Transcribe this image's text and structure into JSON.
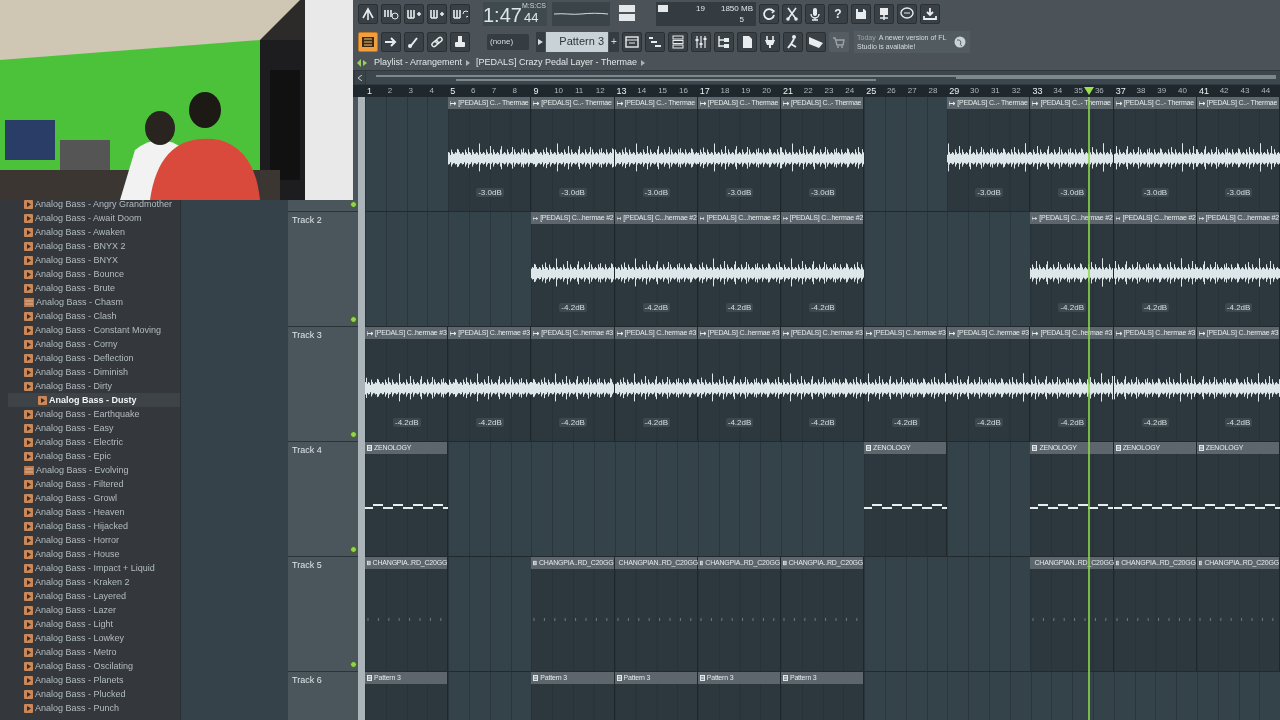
{
  "toolbar": {
    "time": "1:47",
    "time_cs": "44",
    "time_label": "M:S:CS",
    "cpu": "19",
    "memory": "1850 MB",
    "polyphony": "5",
    "help_button": "?",
    "pattern_mode": "(none)",
    "pattern": "Pattern 3",
    "add_pattern": "+",
    "news_date": "Today",
    "news_message": "A newer version of FL Studio is available!"
  },
  "breadcrumb": {
    "title": "Playlist - Arrangement",
    "item": "[PEDALS] Crazy Pedal Layer - Thermae"
  },
  "browser": {
    "items": [
      {
        "label": "Analog Bass - Angry Grandmother",
        "kind": "preset",
        "selected": false
      },
      {
        "label": "Analog Bass - Await Doom",
        "kind": "preset",
        "selected": false
      },
      {
        "label": "Analog Bass - Awaken",
        "kind": "preset",
        "selected": false
      },
      {
        "label": "Analog Bass - BNYX 2",
        "kind": "preset",
        "selected": false
      },
      {
        "label": "Analog Bass - BNYX",
        "kind": "preset",
        "selected": false
      },
      {
        "label": "Analog Bass - Bounce",
        "kind": "preset",
        "selected": false
      },
      {
        "label": "Analog Bass - Brute",
        "kind": "preset",
        "selected": false
      },
      {
        "label": "Analog Bass - Chasm",
        "kind": "audio",
        "selected": false
      },
      {
        "label": "Analog Bass - Clash",
        "kind": "preset",
        "selected": false
      },
      {
        "label": "Analog Bass - Constant Moving",
        "kind": "preset",
        "selected": false
      },
      {
        "label": "Analog Bass - Corny",
        "kind": "preset",
        "selected": false
      },
      {
        "label": "Analog Bass - Deflection",
        "kind": "preset",
        "selected": false
      },
      {
        "label": "Analog Bass - Diminish",
        "kind": "preset",
        "selected": false
      },
      {
        "label": "Analog Bass - Dirty",
        "kind": "preset",
        "selected": false
      },
      {
        "label": "Analog Bass - Dusty",
        "kind": "preset",
        "selected": true
      },
      {
        "label": "Analog Bass - Earthquake",
        "kind": "preset",
        "selected": false
      },
      {
        "label": "Analog Bass - Easy",
        "kind": "preset",
        "selected": false
      },
      {
        "label": "Analog Bass - Electric",
        "kind": "preset",
        "selected": false
      },
      {
        "label": "Analog Bass - Epic",
        "kind": "preset",
        "selected": false
      },
      {
        "label": "Analog Bass - Evolving",
        "kind": "audio",
        "selected": false
      },
      {
        "label": "Analog Bass - Filtered",
        "kind": "preset",
        "selected": false
      },
      {
        "label": "Analog Bass - Growl",
        "kind": "preset",
        "selected": false
      },
      {
        "label": "Analog Bass - Heaven",
        "kind": "preset",
        "selected": false
      },
      {
        "label": "Analog Bass - Hijacked",
        "kind": "preset",
        "selected": false
      },
      {
        "label": "Analog Bass - Horror",
        "kind": "preset",
        "selected": false
      },
      {
        "label": "Analog Bass - House",
        "kind": "preset",
        "selected": false
      },
      {
        "label": "Analog Bass - Impact + Liquid",
        "kind": "preset",
        "selected": false
      },
      {
        "label": "Analog Bass - Kraken 2",
        "kind": "preset",
        "selected": false
      },
      {
        "label": "Analog Bass - Layered",
        "kind": "preset",
        "selected": false
      },
      {
        "label": "Analog Bass - Lazer",
        "kind": "preset",
        "selected": false
      },
      {
        "label": "Analog Bass - Light",
        "kind": "preset",
        "selected": false
      },
      {
        "label": "Analog Bass - Lowkey",
        "kind": "preset",
        "selected": false
      },
      {
        "label": "Analog Bass - Metro",
        "kind": "preset",
        "selected": false
      },
      {
        "label": "Analog Bass - Oscilating",
        "kind": "preset",
        "selected": false
      },
      {
        "label": "Analog Bass - Planets",
        "kind": "preset",
        "selected": false
      },
      {
        "label": "Analog Bass - Plucked",
        "kind": "preset",
        "selected": false
      },
      {
        "label": "Analog Bass - Punch",
        "kind": "preset",
        "selected": false
      }
    ]
  },
  "ruler": {
    "bars": [
      "1",
      "2",
      "3",
      "4",
      "5",
      "6",
      "7",
      "8",
      "9",
      "10",
      "11",
      "12",
      "13",
      "14",
      "15",
      "16",
      "17",
      "18",
      "19",
      "20",
      "21",
      "22",
      "23",
      "24",
      "25",
      "26",
      "27",
      "28",
      "29",
      "30",
      "31",
      "32",
      "33",
      "34",
      "35",
      "36",
      "37",
      "38",
      "39",
      "40",
      "41",
      "42",
      "43",
      "44"
    ]
  },
  "playhead": {
    "level": 0.791
  },
  "tracks": [
    {
      "kind": "audio",
      "slots": [
        {
          "kind": "empty"
        },
        {
          "kind": "clip",
          "label": "[PEDALS] C..- Thermae",
          "gain": "-3.0dB"
        },
        {
          "kind": "clip",
          "label": "[PEDALS] C..- Thermae",
          "gain": "-3.0dB"
        },
        {
          "kind": "clip",
          "label": "[PEDALS] C..- Thermae",
          "gain": "-3.0dB"
        },
        {
          "kind": "clip",
          "label": "[PEDALS] C..- Thermae",
          "gain": "-3.0dB"
        },
        {
          "kind": "clip",
          "label": "[PEDALS] C..- Thermae",
          "gain": "-3.0dB"
        },
        {
          "kind": "empty"
        },
        {
          "kind": "clip",
          "label": "[PEDALS] C..- Thermae",
          "gain": "-3.0dB"
        },
        {
          "kind": "clip",
          "label": "[PEDALS] C..- Thermae",
          "gain": "-3.0dB"
        },
        {
          "kind": "clip",
          "label": "[PEDALS] C..- Thermae",
          "gain": "-3.0dB"
        },
        {
          "kind": "clip",
          "label": "[PEDALS] C..- Thermae",
          "gain": "-3.0dB"
        }
      ]
    },
    {
      "name": "Track 2",
      "kind": "audio",
      "slots": [
        {
          "kind": "empty"
        },
        {
          "kind": "empty"
        },
        {
          "kind": "clip",
          "label": "[PEDALS] C...hermae #2",
          "gain": "-4.2dB"
        },
        {
          "kind": "clip",
          "label": "[PEDALS] C...hermae #2",
          "gain": "-4.2dB"
        },
        {
          "kind": "clip",
          "label": "[PEDALS] C...hermae #2",
          "gain": "-4.2dB"
        },
        {
          "kind": "clip",
          "label": "[PEDALS] C...hermae #2",
          "gain": "-4.2dB"
        },
        {
          "kind": "empty"
        },
        {
          "kind": "empty"
        },
        {
          "kind": "clip",
          "label": "[PEDALS] C...hermae #2",
          "gain": "-4.2dB"
        },
        {
          "kind": "clip",
          "label": "[PEDALS] C...hermae #2",
          "gain": "-4.2dB"
        },
        {
          "kind": "clip",
          "label": "[PEDALS] C...hermae #2",
          "gain": "-4.2dB"
        }
      ]
    },
    {
      "name": "Track 3",
      "kind": "audio",
      "slots": [
        {
          "kind": "clip",
          "label": "[PEDALS] C..hermae #3",
          "gain": "-4.2dB"
        },
        {
          "kind": "clip",
          "label": "[PEDALS] C..hermae #3",
          "gain": "-4.2dB"
        },
        {
          "kind": "clip",
          "label": "[PEDALS] C..hermae #3",
          "gain": "-4.2dB"
        },
        {
          "kind": "clip",
          "label": "[PEDALS] C..hermae #3",
          "gain": "-4.2dB"
        },
        {
          "kind": "clip",
          "label": "[PEDALS] C..hermae #3",
          "gain": "-4.2dB"
        },
        {
          "kind": "clip",
          "label": "[PEDALS] C..hermae #3",
          "gain": "-4.2dB"
        },
        {
          "kind": "clip",
          "label": "[PEDALS] C..hermae #3",
          "gain": "-4.2dB"
        },
        {
          "kind": "clip",
          "label": "[PEDALS] C..hermae #3",
          "gain": "-4.2dB"
        },
        {
          "kind": "clip",
          "label": "[PEDALS] C..hermae #3",
          "gain": "-4.2dB"
        },
        {
          "kind": "clip",
          "label": "[PEDALS] C..hermae #3",
          "gain": "-4.2dB"
        },
        {
          "kind": "clip",
          "label": "[PEDALS] C..hermae #3",
          "gain": "-4.2dB"
        }
      ]
    },
    {
      "name": "Track 4",
      "kind": "notes",
      "slots": [
        {
          "kind": "clip",
          "label": "ZENOLOGY"
        },
        {
          "kind": "empty"
        },
        {
          "kind": "empty"
        },
        {
          "kind": "empty"
        },
        {
          "kind": "empty"
        },
        {
          "kind": "empty"
        },
        {
          "kind": "clip",
          "label": "ZENOLOGY"
        },
        {
          "kind": "empty"
        },
        {
          "kind": "clip",
          "label": "ZENOLOGY"
        },
        {
          "kind": "clip",
          "label": "ZENOLOGY"
        },
        {
          "kind": "clip",
          "label": "ZENOLOGY"
        }
      ]
    },
    {
      "name": "Track 5",
      "kind": "hits",
      "slots": [
        {
          "kind": "clip",
          "label": "CHANGPIA..RD_C20GG"
        },
        {
          "kind": "empty"
        },
        {
          "kind": "clip",
          "label": "CHANGPIA..RD_C20GG"
        },
        {
          "kind": "clip",
          "label": "CHANGPIAN..RD_C20GG"
        },
        {
          "kind": "clip",
          "label": "CHANGPIA..RD_C20GG"
        },
        {
          "kind": "clip",
          "label": "CHANGPIA..RD_C20GG"
        },
        {
          "kind": "empty"
        },
        {
          "kind": "empty"
        },
        {
          "kind": "clip",
          "label": "CHANGPIAN..RD_C20GG"
        },
        {
          "kind": "clip",
          "label": "CHANGPIA..RD_C20GG"
        },
        {
          "kind": "clip",
          "label": "CHANGPIA..RD_C20GG"
        }
      ]
    },
    {
      "name": "Track 6",
      "kind": "pattern",
      "slots": [
        {
          "kind": "clip",
          "label": "Pattern 3"
        },
        {
          "kind": "empty"
        },
        {
          "kind": "clip",
          "label": "Pattern 3"
        },
        {
          "kind": "clip",
          "label": "Pattern 3"
        },
        {
          "kind": "clip",
          "label": "Pattern 3"
        },
        {
          "kind": "clip",
          "label": "Pattern 3"
        }
      ]
    }
  ]
}
